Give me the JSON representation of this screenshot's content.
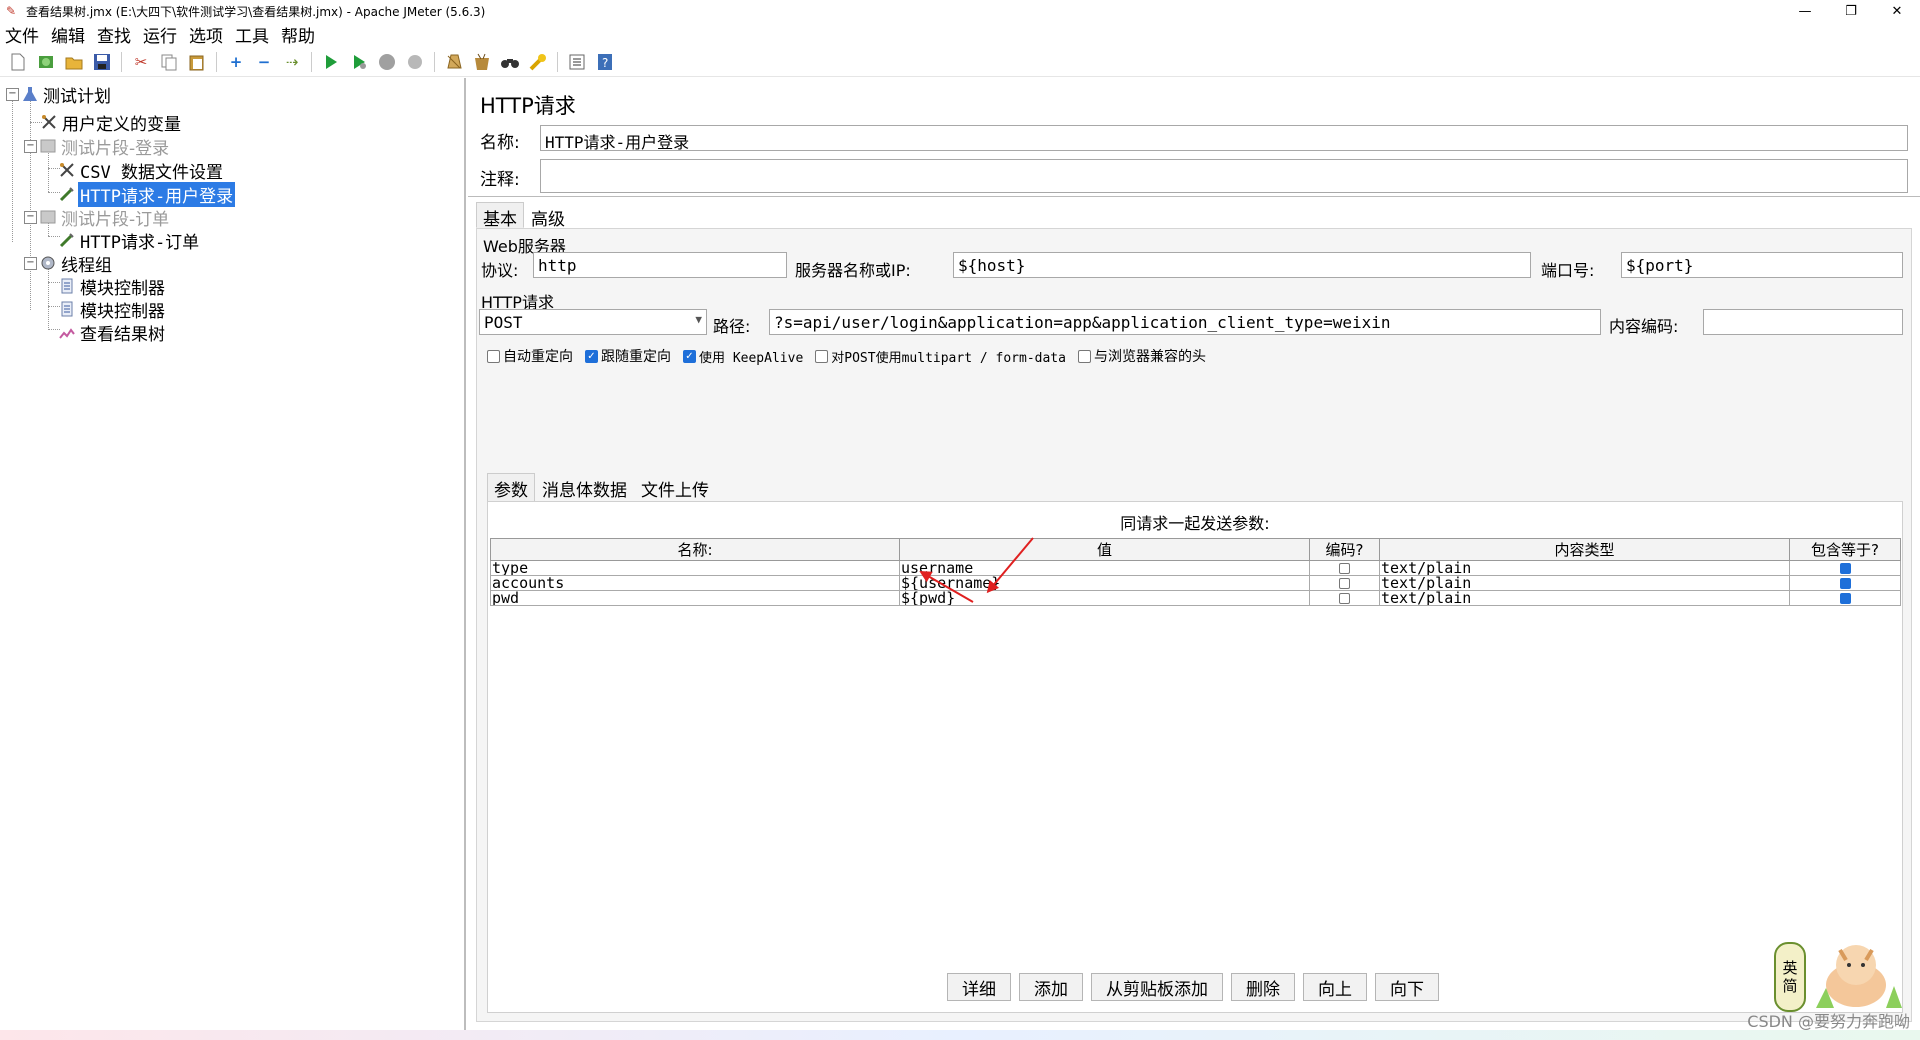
{
  "window": {
    "title": "查看结果树.jmx (E:\\大四下\\软件测试学习\\查看结果树.jmx) - Apache JMeter (5.6.3)",
    "controls": {
      "minimize": "—",
      "maximize": "❐",
      "close": "✕"
    }
  },
  "menu": [
    "文件",
    "编辑",
    "查找",
    "运行",
    "选项",
    "工具",
    "帮助"
  ],
  "toolbar": [
    "new-icon",
    "templates-icon",
    "open-icon",
    "save-icon",
    "|",
    "cut-icon",
    "copy-icon",
    "paste-icon",
    "|",
    "expand-icon",
    "collapse-icon",
    "toggle-icon",
    "|",
    "start-icon",
    "start-no-pause-icon",
    "stop-icon",
    "shutdown-icon",
    "|",
    "clear-icon",
    "clear-all-icon",
    "search-icon",
    "reset-search-icon",
    "function-helper-icon",
    "help-icon"
  ],
  "tree": [
    {
      "label": "测试计划",
      "icon": "test-plan-icon",
      "level": 0,
      "toggle": "−",
      "disabled": false,
      "selected": false
    },
    {
      "label": "用户定义的变量",
      "icon": "config-element-icon",
      "level": 1,
      "disabled": false,
      "selected": false
    },
    {
      "label": "测试片段-登录",
      "icon": "test-fragment-icon",
      "level": 1,
      "toggle": "−",
      "disabled": true,
      "selected": false
    },
    {
      "label": "CSV 数据文件设置",
      "icon": "config-element-icon",
      "level": 2,
      "disabled": false,
      "selected": false
    },
    {
      "label": "HTTP请求-用户登录",
      "icon": "sampler-icon",
      "level": 2,
      "disabled": false,
      "selected": true
    },
    {
      "label": "测试片段-订单",
      "icon": "test-fragment-icon",
      "level": 1,
      "toggle": "−",
      "disabled": true,
      "selected": false
    },
    {
      "label": "HTTP请求-订单",
      "icon": "sampler-icon",
      "level": 2,
      "disabled": false,
      "selected": false
    },
    {
      "label": "线程组",
      "icon": "thread-group-icon",
      "level": 1,
      "toggle": "−",
      "disabled": false,
      "selected": false
    },
    {
      "label": "模块控制器",
      "icon": "controller-icon",
      "level": 2,
      "disabled": false,
      "selected": false
    },
    {
      "label": "模块控制器",
      "icon": "controller-icon",
      "level": 2,
      "disabled": false,
      "selected": false
    },
    {
      "label": "查看结果树",
      "icon": "listener-icon",
      "level": 2,
      "disabled": false,
      "selected": false
    }
  ],
  "editor": {
    "title": "HTTP请求",
    "name_label": "名称:",
    "name_value": "HTTP请求-用户登录",
    "comment_label": "注释:",
    "comment_value": "",
    "tabs": [
      "基本",
      "高级"
    ],
    "web_server": {
      "title": "Web服务器",
      "protocol_label": "协议:",
      "protocol_value": "http",
      "server_label": "服务器名称或IP:",
      "server_value": "${host}",
      "port_label": "端口号:",
      "port_value": "${port}"
    },
    "http_request": {
      "title": "HTTP请求",
      "method": "POST",
      "path_label": "路径:",
      "path_value": "?s=api/user/login&application=app&application_client_type=weixin",
      "encoding_label": "内容编码:",
      "encoding_value": ""
    },
    "options": [
      {
        "label": "自动重定向",
        "checked": false
      },
      {
        "label": "跟随重定向",
        "checked": true
      },
      {
        "label": "使用 KeepAlive",
        "checked": true
      },
      {
        "label": "对POST使用multipart / form-data",
        "checked": false
      },
      {
        "label": "与浏览器兼容的头",
        "checked": false
      }
    ],
    "subtabs": [
      "参数",
      "消息体数据",
      "文件上传"
    ],
    "params_caption": "同请求一起发送参数:",
    "params_columns": [
      "名称:",
      "值",
      "编码?",
      "内容类型",
      "包含等于?"
    ],
    "params_rows": [
      {
        "name": "type",
        "value": "username",
        "encode": false,
        "content_type": "text/plain",
        "include_equals": true
      },
      {
        "name": "accounts",
        "value": "${username}",
        "encode": false,
        "content_type": "text/plain",
        "include_equals": true
      },
      {
        "name": "pwd",
        "value": "${pwd}",
        "encode": false,
        "content_type": "text/plain",
        "include_equals": true
      }
    ],
    "buttons": [
      "详细",
      "添加",
      "从剪贴板添加",
      "删除",
      "向上",
      "向下"
    ]
  },
  "overlay": {
    "ime_badge": [
      "英",
      "简"
    ],
    "watermark": "CSDN @要努力奔跑呦"
  },
  "colors": {
    "selection": "#2c7be5",
    "checkbox": "#1e6fd9",
    "annotation_arrow": "#e02020"
  }
}
